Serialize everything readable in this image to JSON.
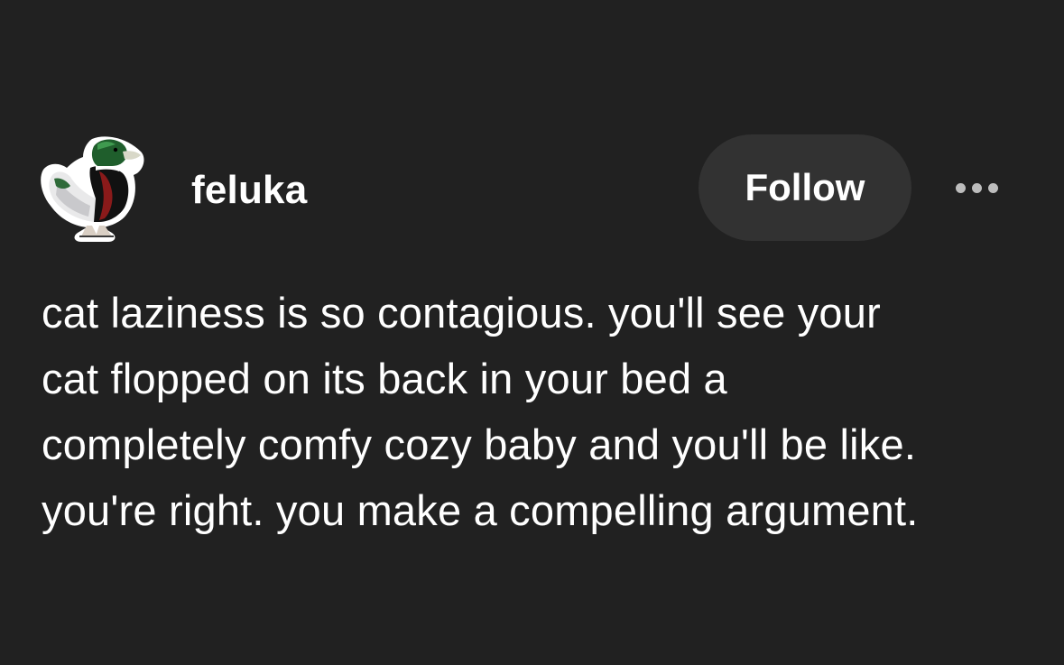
{
  "post": {
    "author": {
      "username": "feluka",
      "avatar_icon": "mallard-duck-avatar"
    },
    "follow_label": "Follow",
    "more_icon": "more-options-icon",
    "body_lines": [
      "cat laziness is so contagious. you'll see your",
      "cat flopped on its back in your bed a",
      "completely comfy cozy baby and you'll be like.",
      "you're right. you make a compelling argument."
    ]
  },
  "colors": {
    "background": "#212121",
    "button": "#323232",
    "text": "#ffffff",
    "dots": "#bdbdbd"
  }
}
